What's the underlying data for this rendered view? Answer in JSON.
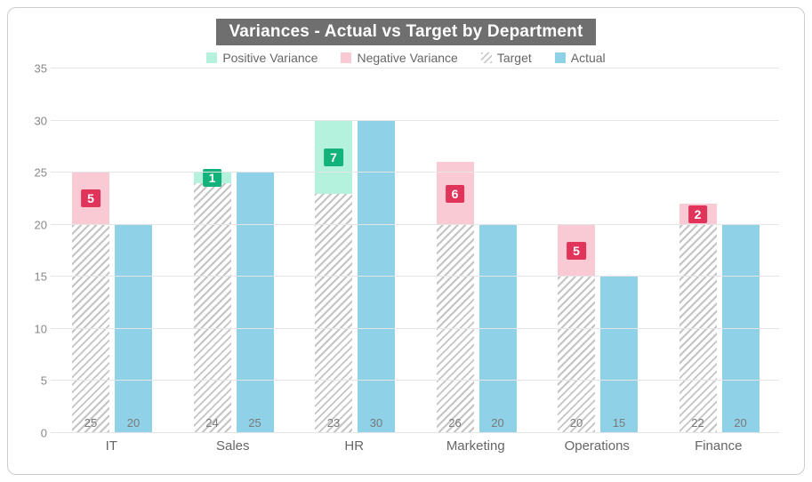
{
  "chart_data": {
    "type": "bar",
    "title": "Variances - Actual vs Target by Department",
    "categories": [
      "IT",
      "Sales",
      "HR",
      "Marketing",
      "Operations",
      "Finance"
    ],
    "series": [
      {
        "name": "Target",
        "values": [
          25,
          24,
          23,
          26,
          20,
          22
        ]
      },
      {
        "name": "Actual",
        "values": [
          20,
          25,
          30,
          20,
          15,
          20
        ]
      },
      {
        "name": "Variance",
        "values": [
          -5,
          1,
          7,
          -6,
          -5,
          -2
        ]
      }
    ],
    "y_ticks": [
      0,
      5,
      10,
      15,
      20,
      25,
      30,
      35
    ],
    "ylim": [
      0,
      35
    ],
    "legend": [
      "Positive Variance",
      "Negative Variance",
      "Target",
      "Actual"
    ],
    "colors": {
      "positive": "#b5f2dd",
      "negative": "#f9c9d4",
      "target_pattern": "diagonal-hatch-gray",
      "actual": "#8fd1e6",
      "badge_positive": "#13b27a",
      "badge_negative": "#e0345a"
    }
  }
}
